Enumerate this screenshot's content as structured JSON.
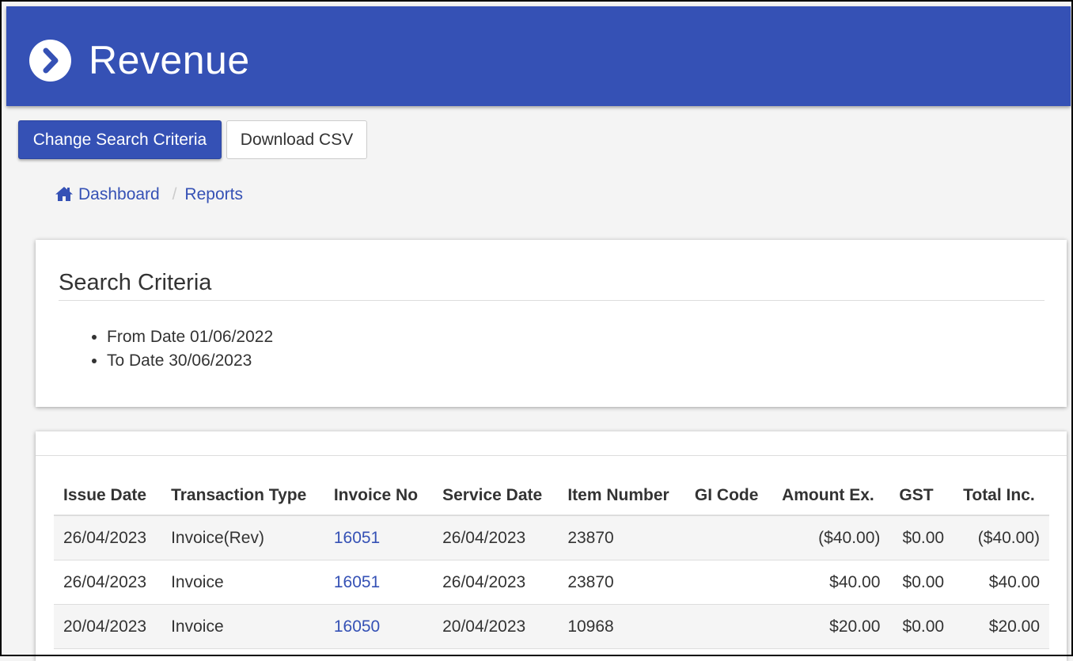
{
  "header": {
    "title": "Revenue",
    "icon": "chevron-right-circle-icon",
    "background_color": "#3551b5"
  },
  "toolbar": {
    "change_search_label": "Change Search Criteria",
    "download_csv_label": "Download CSV"
  },
  "breadcrumb": {
    "home_icon": "home-icon",
    "items": [
      "Dashboard",
      "Reports"
    ],
    "separator": "/"
  },
  "search_criteria": {
    "title": "Search Criteria",
    "items": [
      "From Date 01/06/2022",
      "To Date 30/06/2023"
    ]
  },
  "table": {
    "columns": [
      "Issue Date",
      "Transaction Type",
      "Invoice No",
      "Service Date",
      "Item Number",
      "GI Code",
      "Amount Ex.",
      "GST",
      "Total Inc."
    ],
    "rows": [
      {
        "issue_date": "26/04/2023",
        "transaction_type": "Invoice(Rev)",
        "invoice_no": "16051",
        "service_date": "26/04/2023",
        "item_number": "23870",
        "gl_code": "",
        "amount_ex": "($40.00)",
        "gst": "$0.00",
        "total_inc": "($40.00)"
      },
      {
        "issue_date": "26/04/2023",
        "transaction_type": "Invoice",
        "invoice_no": "16051",
        "service_date": "26/04/2023",
        "item_number": "23870",
        "gl_code": "",
        "amount_ex": "$40.00",
        "gst": "$0.00",
        "total_inc": "$40.00"
      },
      {
        "issue_date": "20/04/2023",
        "transaction_type": "Invoice",
        "invoice_no": "16050",
        "service_date": "20/04/2023",
        "item_number": "10968",
        "gl_code": "",
        "amount_ex": "$20.00",
        "gst": "$0.00",
        "total_inc": "$20.00"
      }
    ]
  }
}
